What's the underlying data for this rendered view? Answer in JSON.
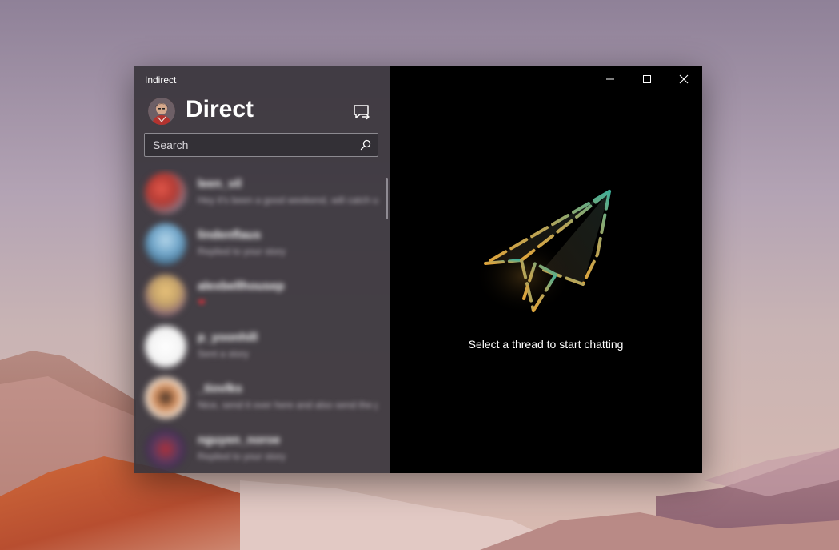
{
  "window": {
    "app_title": "Indirect",
    "header_title": "Direct"
  },
  "search": {
    "placeholder": "Search"
  },
  "threads": [
    {
      "name": "leen_vil",
      "preview": "Hey it's been a good weekend, will catch up soon",
      "avatar_color": "#c9453a"
    },
    {
      "name": "lindenflaus",
      "preview": "Replied to your story",
      "avatar_color": "#6fa4c8"
    },
    {
      "name": "alexbellhousep",
      "preview": "❤",
      "avatar_color": "#c6a46a"
    },
    {
      "name": "p_yoonhill",
      "preview": "Sent a story",
      "avatar_color": "#f2f2f2"
    },
    {
      "name": "_tiovlks",
      "preview": "Nice, send it over here and also send the photo",
      "avatar_color": "#d08b5a"
    },
    {
      "name": "nguyen_noroe",
      "preview": "Replied to your story",
      "avatar_color": "#5a3a5e"
    }
  ],
  "empty_state": {
    "message": "Select a thread to start chatting"
  },
  "colors": {
    "pane_bg": "#3a363c",
    "right_bg": "#000000",
    "plane_orange": "#e0a43a",
    "plane_teal": "#3fae98"
  },
  "icons": {
    "new_chat": "new-message-icon",
    "search": "search-icon",
    "minimize": "minimize-icon",
    "maximize": "maximize-icon",
    "close": "close-icon"
  }
}
